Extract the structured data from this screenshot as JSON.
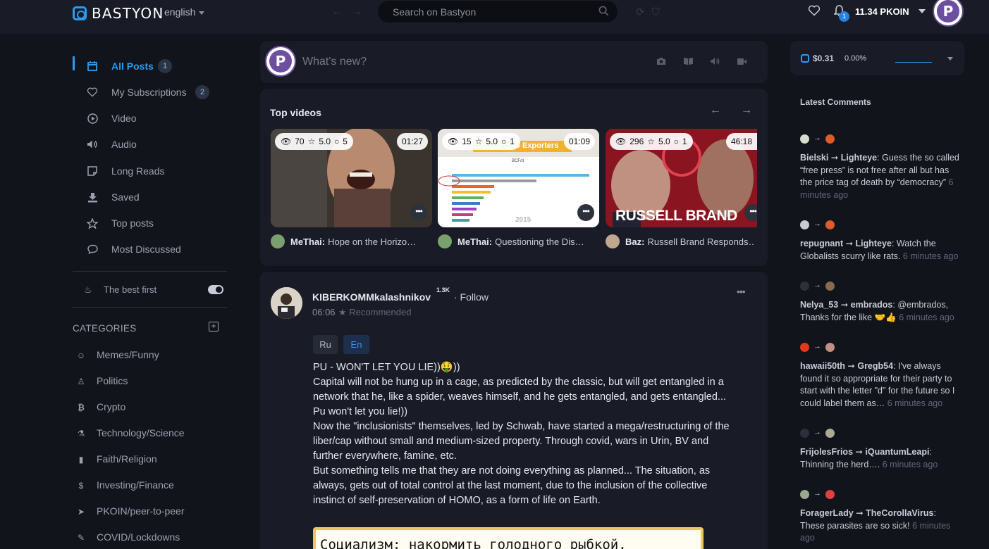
{
  "header": {
    "logo_text": "BASTYON",
    "language": "english",
    "search_placeholder": "Search on Bastyon",
    "notifications_count": "1",
    "balance": "11.34 PKOIN",
    "avatar_letter": "P"
  },
  "sidebar": {
    "items": [
      {
        "label": "All Posts",
        "badge": "1",
        "icon": "calendar-icon"
      },
      {
        "label": "My Subscriptions",
        "badge": "2",
        "icon": "heart-icon"
      },
      {
        "label": "Video",
        "icon": "play-icon"
      },
      {
        "label": "Audio",
        "icon": "speaker-icon"
      },
      {
        "label": "Long Reads",
        "icon": "note-icon"
      },
      {
        "label": "Saved",
        "icon": "download-icon"
      },
      {
        "label": "Top posts",
        "icon": "star-icon"
      },
      {
        "label": "Most Discussed",
        "icon": "comment-icon"
      }
    ],
    "sort_label": "The best first",
    "categories_title": "CATEGORIES",
    "categories": [
      {
        "label": "Memes/Funny",
        "icon": "smile-icon"
      },
      {
        "label": "Politics",
        "icon": "person-icon"
      },
      {
        "label": "Crypto",
        "icon": "bitcoin-icon"
      },
      {
        "label": "Technology/Science",
        "icon": "microscope-icon"
      },
      {
        "label": "Faith/Religion",
        "icon": "book-icon"
      },
      {
        "label": "Investing/Finance",
        "icon": "dollar-icon"
      },
      {
        "label": "PKOIN/peer-to-peer",
        "icon": "cursor-icon"
      },
      {
        "label": "COVID/Lockdowns",
        "icon": "syringe-icon"
      }
    ]
  },
  "compose": {
    "placeholder": "What's new?",
    "avatar_letter": "P"
  },
  "top_videos": {
    "title": "Top videos",
    "videos": [
      {
        "views": "70",
        "rating": "5.0",
        "comments": "5",
        "duration": "01:27",
        "author": "MeThai:",
        "title": "Hope on the Horizo…"
      },
      {
        "views": "15",
        "rating": "5.0",
        "comments": "1",
        "duration": "01:09",
        "author": "MeThai:",
        "title": "Questioning the Dis…",
        "banner": "Top 10 LNG Exporters",
        "chart_label": "BCF/d",
        "year": "2015"
      },
      {
        "views": "296",
        "rating": "5.0",
        "comments": "1",
        "duration": "46:18",
        "author": "Baz:",
        "title": "Russell Brand Responds…",
        "banner": "RUSSELL BRAND"
      }
    ]
  },
  "post": {
    "author": "KIBERKOMMkalashnikov",
    "reputation": "1.3K",
    "follow": "· Follow",
    "time": "06:06",
    "recommended": "Recommended",
    "lang_ru": "Ru",
    "lang_en": "En",
    "paragraphs": [
      "PU - WON'T LET YOU LIE))🤑))",
      "Capital will not be hung up in a cage, as predicted by the classic, but will get entangled in a network that he, like a spider, weaves himself, and he gets entangled, and gets entangled... Pu won't let you lie!))",
      "Now the \"inclusionists\" themselves, led by Schwab, have started a mega/restructuring of the liber/cap without small and medium-sized property. Through covid, wars in Urin, BV and further everywhere, famine, etc.",
      "But something tells me that they are not doing everything as planned... The situation, as always, gets out of total control at the last moment, due to the inclusion of the collective instinct of self-preservation of HOMO, as a form of life on Earth."
    ],
    "image_caption": "Социализм: накормить голодного рыбкой."
  },
  "wallet": {
    "price": "$0.31",
    "change": "0.00%"
  },
  "latest_comments": {
    "title": "Latest Comments",
    "items": [
      {
        "from": "Bielski",
        "to": "Lighteye",
        "text": "Guess the so called “free press” is not free after all but has the price tag of death by “democracy”",
        "ago": "6 minutes ago",
        "c1": "#d8dccf",
        "c2": "#e05a2a"
      },
      {
        "from": "repugnant",
        "to": "Lighteye",
        "text": "Watch the Globalists scurry like rats.",
        "ago": "6 minutes ago",
        "c1": "#c8ccd6",
        "c2": "#e05a2a"
      },
      {
        "from": "Nelya_53",
        "to": "embrados",
        "text": "@embrados, Thanks for the like 🤝👍",
        "ago": "6 minutes ago",
        "c1": "#2c303c",
        "c2": "#8a6a4a"
      },
      {
        "from": "hawaii50th",
        "to": "Gregb54",
        "text": "I've always found it so appropriate for their party to start with the letter \"d\" for the future so I could label them as…",
        "ago": "6 minutes ago",
        "c1": "#e03a1a",
        "c2": "#c09080"
      },
      {
        "from": "FrijolesFrios",
        "to": "iQuantumLeapi",
        "text": "Thinning the herd….",
        "ago": "6 minutes ago",
        "c1": "#2c303c",
        "c2": "#b0a890"
      },
      {
        "from": "ForagerLady",
        "to": "TheCorollaVirus",
        "text": "These parasites are so sick!",
        "ago": "6 minutes ago",
        "c1": "#9aa890",
        "c2": "#e04040"
      }
    ]
  }
}
